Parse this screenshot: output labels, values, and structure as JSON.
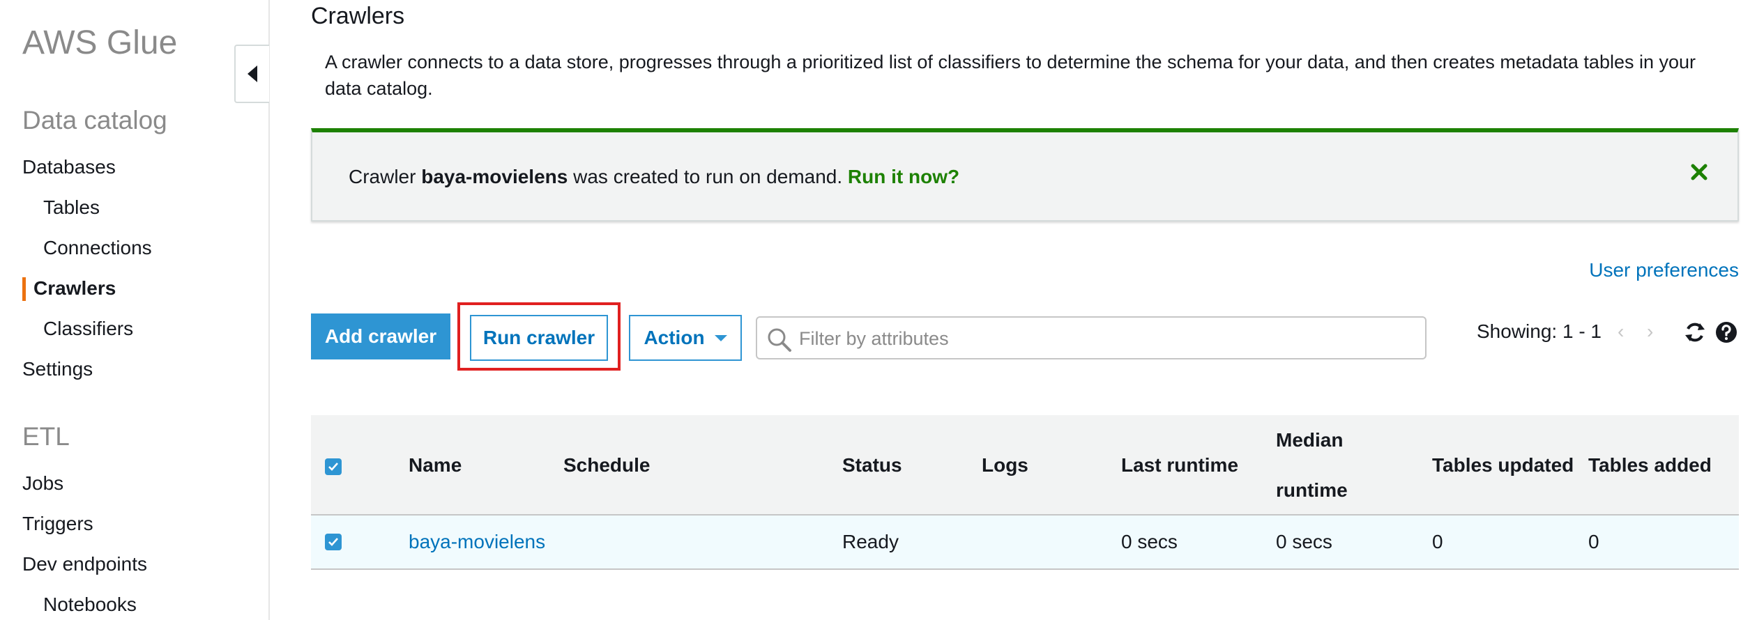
{
  "sidebar": {
    "brand": "AWS Glue",
    "data_catalog_title": "Data catalog",
    "databases": "Databases",
    "tables": "Tables",
    "connections": "Connections",
    "crawlers": "Crawlers",
    "classifiers": "Classifiers",
    "settings": "Settings",
    "etl_title": "ETL",
    "jobs": "Jobs",
    "triggers": "Triggers",
    "dev_endpoints": "Dev endpoints",
    "notebooks": "Notebooks"
  },
  "page": {
    "title": "Crawlers",
    "description": "A crawler connects to a data store, progresses through a prioritized list of classifiers to determine the schema for your data, and then creates metadata tables in your data catalog."
  },
  "flash": {
    "prefix": "Crawler ",
    "crawler_name": "baya-movielens",
    "suffix": " was created to run on demand. ",
    "link": "Run it now?"
  },
  "toolbar": {
    "user_preferences": "User preferences",
    "add_crawler": "Add crawler",
    "run_crawler": "Run crawler",
    "action": "Action",
    "search_placeholder": "Filter by attributes",
    "showing": "Showing: 1 - 1"
  },
  "table": {
    "headers": {
      "name": "Name",
      "schedule": "Schedule",
      "status": "Status",
      "logs": "Logs",
      "last_runtime": "Last runtime",
      "median_runtime_1": "Median",
      "median_runtime_2": "runtime",
      "tables_updated": "Tables updated",
      "tables_added": "Tables added"
    },
    "rows": [
      {
        "name": "baya-movielens",
        "schedule": "",
        "status": "Ready",
        "logs": "",
        "last_runtime": "0 secs",
        "median_runtime": "0 secs",
        "tables_updated": "0",
        "tables_added": "0",
        "selected": true
      }
    ]
  },
  "colors": {
    "primary": "#2e95d3",
    "link": "#0073bb",
    "success": "#1d8102",
    "active_marker": "#ec7211",
    "highlight": "#e02020"
  }
}
